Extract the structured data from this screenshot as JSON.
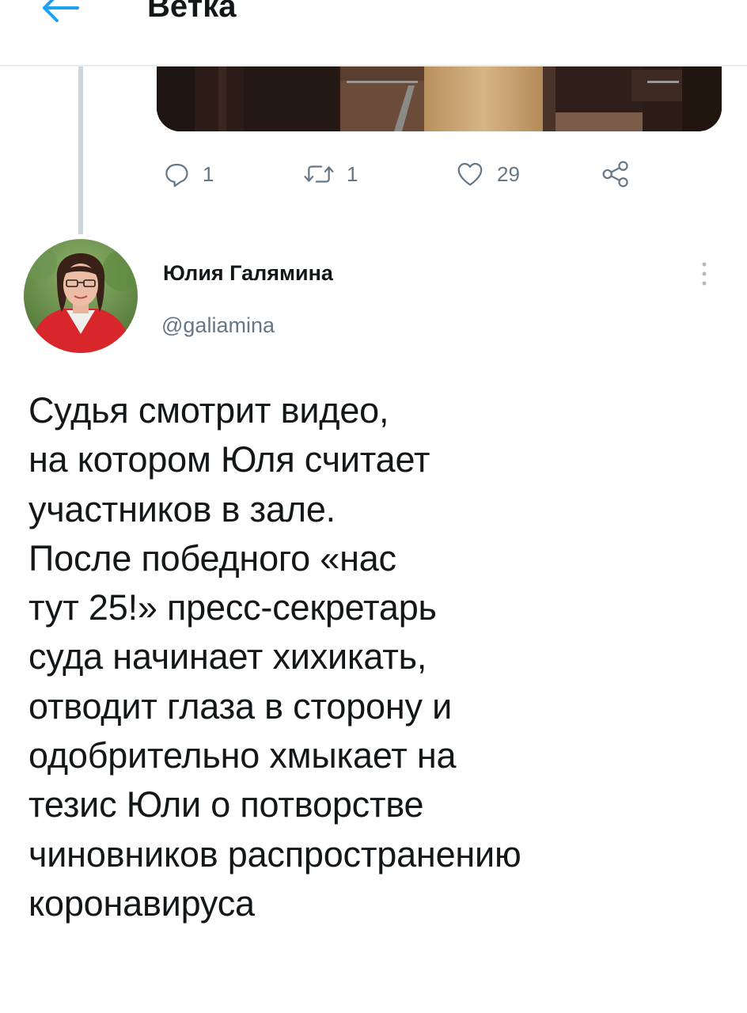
{
  "header": {
    "title": "Ветка",
    "back_icon": "arrow-left-icon"
  },
  "previous_tweet": {
    "media": "photo",
    "actions": {
      "reply": {
        "icon": "reply-icon",
        "count": "1"
      },
      "retweet": {
        "icon": "retweet-icon",
        "count": "1"
      },
      "like": {
        "icon": "heart-icon",
        "count": "29"
      },
      "share": {
        "icon": "share-icon"
      }
    }
  },
  "tweet": {
    "author": {
      "name": "Юлия Галямина",
      "handle": "@galiamina",
      "avatar": "avatar-photo"
    },
    "more_icon": "more-vertical-icon",
    "text": "Судья смотрит видео,\nна котором Юля считает\nучастников в зале.\nПосле победного «нас\nтут 25!» пресс-секретарь\nсуда начинает хихикать,\nотводит глаза в сторону и\nодобрительно хмыкает на\nтезис Юли о потворстве\nчиновников распространению\nкоронавируса"
  },
  "colors": {
    "accent": "#1da1f2",
    "text": "#14171a",
    "secondary": "#657786",
    "divider": "#e6ecf0",
    "thread_line": "#ccd6dd"
  }
}
